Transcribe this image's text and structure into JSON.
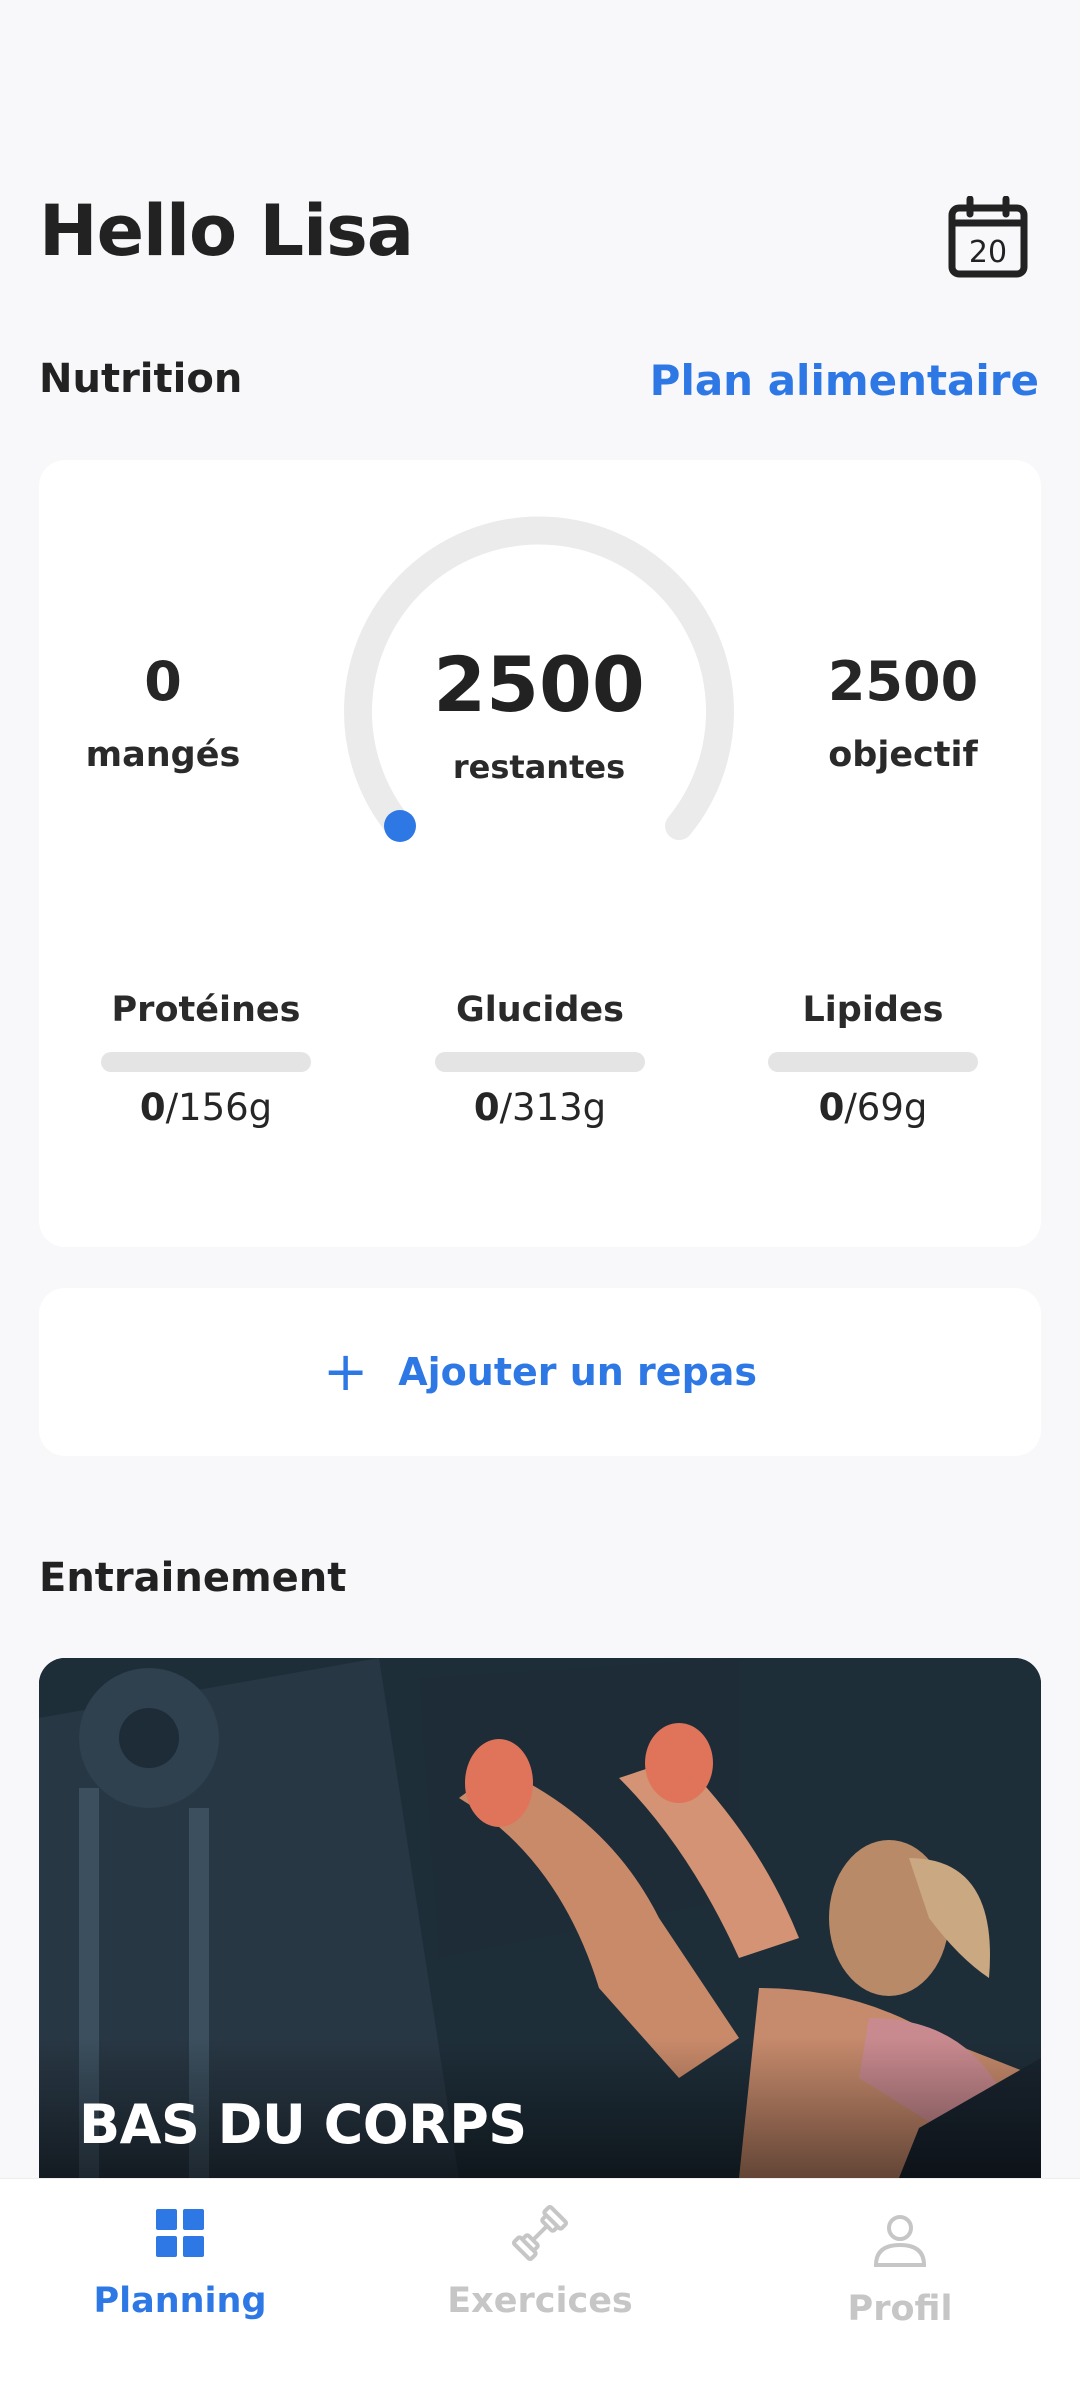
{
  "header": {
    "greeting": "Hello Lisa",
    "calendar_day": "20",
    "calendar_icon": "calendar-icon"
  },
  "nutrition": {
    "section_title": "Nutrition",
    "plan_link": "Plan alimentaire",
    "eaten": {
      "value": "0",
      "label": "mangés"
    },
    "remaining": {
      "value": "2500",
      "label": "restantes"
    },
    "goal": {
      "value": "2500",
      "label": "objectif"
    },
    "gauge_progress": 0,
    "macros": [
      {
        "name": "Protéines",
        "current": "0",
        "target": "/156g",
        "progress": 0
      },
      {
        "name": "Glucides",
        "current": "0",
        "target": "/313g",
        "progress": 0
      },
      {
        "name": "Lipides",
        "current": "0",
        "target": "/69g",
        "progress": 0
      }
    ],
    "add_meal_label": "Ajouter un repas"
  },
  "training": {
    "section_title": "Entrainement",
    "card_title": "BAS DU CORPS"
  },
  "bottom_nav": [
    {
      "label": "Planning",
      "icon": "grid-icon",
      "active": true
    },
    {
      "label": "Exercices",
      "icon": "dumbbell-icon",
      "active": false
    },
    {
      "label": "Profil",
      "icon": "user-icon",
      "active": false
    }
  ],
  "colors": {
    "accent": "#2e78e6",
    "background": "#f8f8fa",
    "card": "#ffffff",
    "track": "#e4e4e4",
    "inactive": "#c6c6c6"
  }
}
